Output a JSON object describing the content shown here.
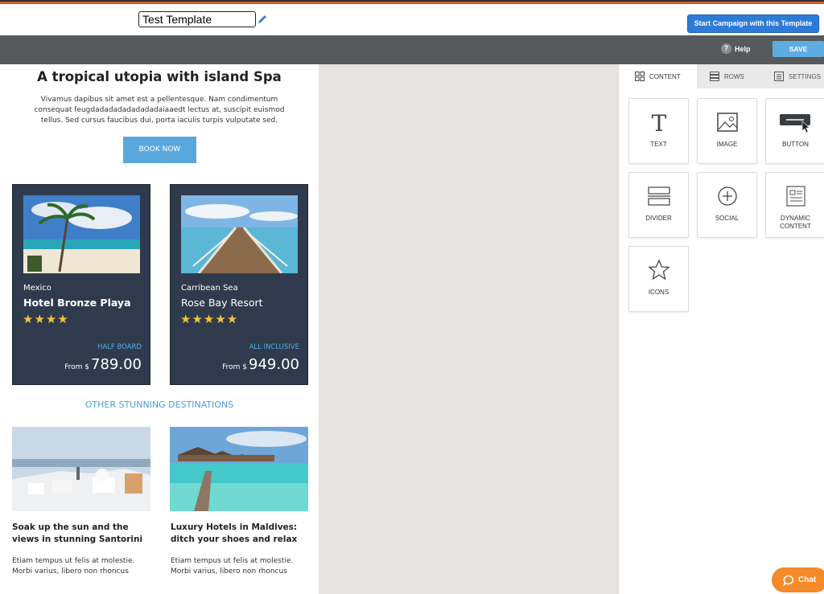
{
  "header": {
    "template_name": "Test Template",
    "start_campaign_label": "Start Campaign with this Template"
  },
  "toolbar": {
    "help_label": "Help",
    "save_label": "SAVE"
  },
  "email": {
    "title": "A tropical utopia with island Spa",
    "intro": "Vivamus dapibus sit amet est a pellentesque. Nam condimentum consequat feugdadadadadadadadaiaaedt lectus at, suscipit euismod tellus. Sed cursus faucibus dui, porta iaculis turpis vulputate sed.",
    "book_label": "BOOK NOW",
    "cards": [
      {
        "location": "Mexico",
        "name": "Hotel Bronze Playa",
        "stars": "★★★★",
        "rating": 4,
        "board": "HALF BOARD",
        "from": "From $",
        "price": "789.00"
      },
      {
        "location": "Carribean Sea",
        "name": "Rose Bay Resort",
        "stars": "★★★★★",
        "rating": 5,
        "board": "ALL INCLUSIVE",
        "from": "From $",
        "price": "949.00"
      }
    ],
    "other_heading": "OTHER STUNNING DESTINATIONS",
    "destinations": [
      {
        "title": "Soak up the sun and the views in stunning Santorini",
        "text": "Etiam tempus ut felis at molestie. Morbi varius, libero non rhoncus"
      },
      {
        "title": "Luxury Hotels in Maldives: ditch your shoes and relax",
        "text": "Etiam tempus ut felis at molestie. Morbi varius, libero non rhoncus"
      }
    ]
  },
  "panel": {
    "tabs": [
      {
        "label": "CONTENT",
        "icon": "grid-icon",
        "active": true
      },
      {
        "label": "ROWS",
        "icon": "rows-icon",
        "active": false
      },
      {
        "label": "SETTINGS",
        "icon": "settings-icon",
        "active": false
      }
    ],
    "blocks": [
      {
        "label": "TEXT",
        "icon": "text-icon"
      },
      {
        "label": "IMAGE",
        "icon": "image-icon"
      },
      {
        "label": "BUTTON",
        "icon": "button-icon"
      },
      {
        "label": "DIVIDER",
        "icon": "divider-icon"
      },
      {
        "label": "SOCIAL",
        "icon": "social-icon"
      },
      {
        "label": "DYNAMIC CONTENT",
        "icon": "dynamic-content-icon"
      },
      {
        "label": "ICONS",
        "icon": "star-icon"
      }
    ]
  },
  "chat_label": "Chat",
  "colors": {
    "primary": "#2e7bd6",
    "save": "#5dade2",
    "card_bg": "#2f3b4c",
    "accent_link": "#4fb0e6",
    "star": "#f5c33b",
    "chat": "#f58a28",
    "orange_bar": "#d9562b"
  }
}
